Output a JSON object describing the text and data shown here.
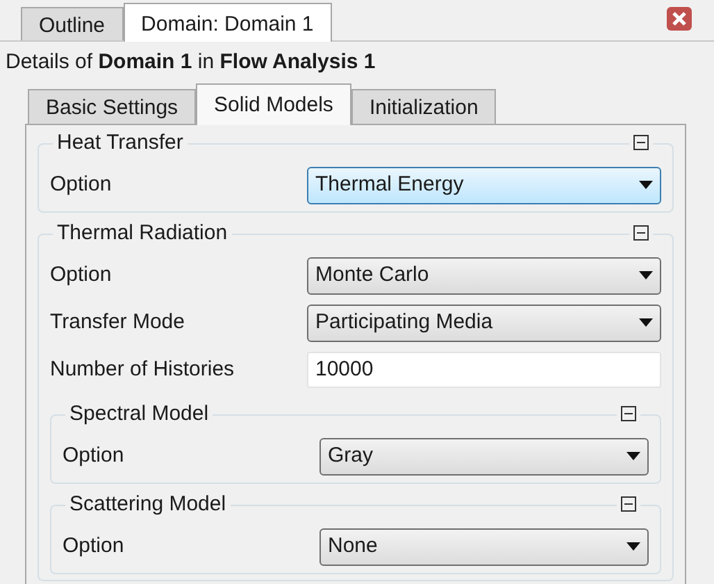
{
  "top_tabs": [
    {
      "label": "Outline",
      "selected": false
    },
    {
      "label": "Domain: Domain 1",
      "selected": true
    }
  ],
  "details": "Details of **Domain 1** in **Flow Analysis 1**",
  "tabs": [
    {
      "label": "Basic Settings",
      "selected": false
    },
    {
      "label": "Solid Models",
      "selected": true
    },
    {
      "label": "Initialization",
      "selected": false
    }
  ],
  "groups": [
    {
      "title": "Heat Transfer",
      "expanded": true,
      "children": [
        {
          "kind": "dropdown",
          "label": "Option",
          "value": "Thermal Energy",
          "focused": true
        }
      ]
    },
    {
      "title": "Thermal Radiation",
      "expanded": true,
      "children": [
        {
          "kind": "dropdown",
          "label": "Option",
          "value": "Monte Carlo",
          "focused": false
        },
        {
          "kind": "dropdown",
          "label": "Transfer Mode",
          "value": "Participating Media",
          "focused": false
        },
        {
          "kind": "text",
          "label": "Number of Histories",
          "value": "10000"
        },
        {
          "kind": "group",
          "title": "Spectral Model",
          "expanded": true,
          "children": [
            {
              "kind": "dropdown",
              "label": "Option",
              "value": "Gray",
              "focused": false
            }
          ]
        },
        {
          "kind": "group",
          "title": "Scattering Model",
          "expanded": true,
          "children": [
            {
              "kind": "dropdown",
              "label": "Option",
              "value": "None",
              "focused": false
            }
          ]
        }
      ]
    }
  ]
}
